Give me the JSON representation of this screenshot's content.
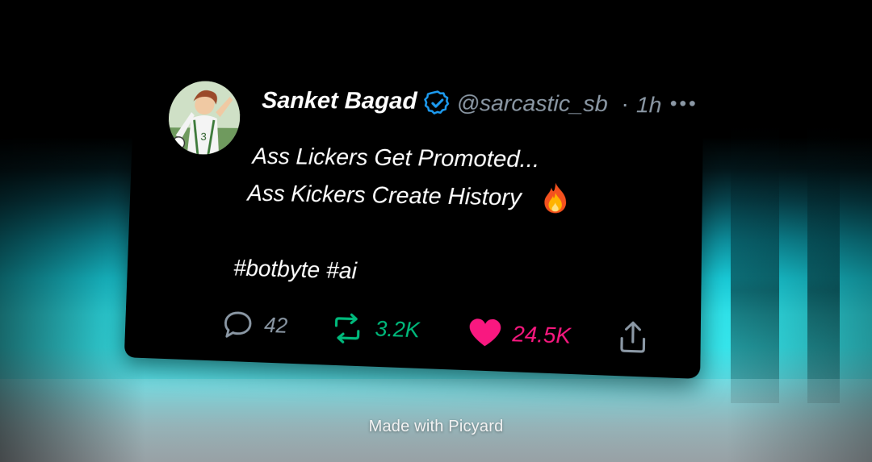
{
  "tweet": {
    "display_name": "Sanket Bagad",
    "handle": "@sarcastic_sb",
    "separator": "·",
    "time": "1h",
    "lines": [
      "Ass Lickers Get Promoted...",
      "Ass Kickers Create History",
      "#botbyte #ai"
    ],
    "avatar_jersey_number": "3",
    "stats": {
      "replies": "42",
      "retweets": "3.2K",
      "likes": "24.5K"
    }
  },
  "icons": {
    "verified": "verified-badge-icon",
    "more": "more-dots-icon",
    "reply": "reply-icon",
    "retweet": "retweet-icon",
    "like": "heart-icon",
    "share": "share-icon",
    "emoji": "fire-emoji"
  },
  "colors": {
    "verified": "#1d9bf0",
    "retweet": "#00ba7c",
    "like": "#f91880",
    "muted": "#8b98a5"
  },
  "watermark": "Made with Picyard"
}
